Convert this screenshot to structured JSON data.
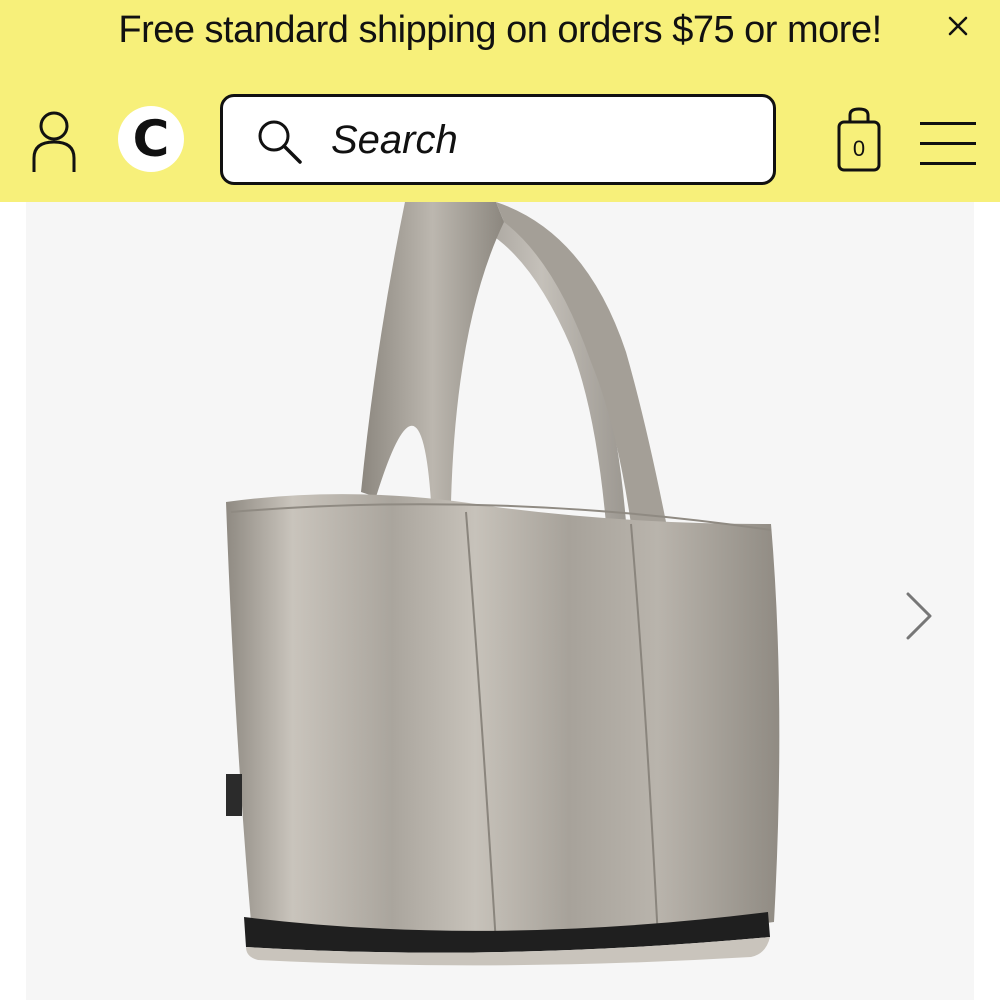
{
  "promo_banner": {
    "text": "Free standard shipping on orders $75 or more!",
    "close_icon": "close-icon"
  },
  "header": {
    "background_color": "#f7f07a",
    "account_icon": "person-icon",
    "logo_letter": "C",
    "search": {
      "placeholder": "Search",
      "value": "",
      "icon": "search-icon"
    },
    "cart": {
      "icon": "shopping-bag-icon",
      "count": "0"
    },
    "menu_icon": "hamburger-menu-icon"
  },
  "product_gallery": {
    "image": "quilted puffer tote bag, metallic taupe",
    "next_icon": "chevron-right-icon"
  }
}
